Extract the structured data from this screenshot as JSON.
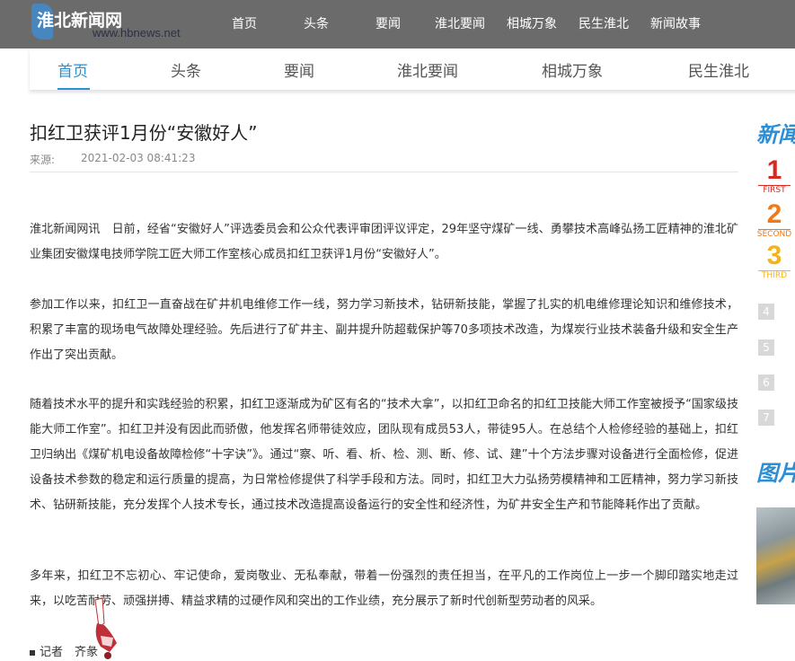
{
  "header": {
    "logo_name": "淮北新闻网",
    "logo_url": "www.hbnews.net",
    "nav": [
      "首页",
      "头条",
      "要闻",
      "淮北要闻",
      "相城万象",
      "民生淮北",
      "新闻故事"
    ]
  },
  "subnav": {
    "items": [
      "首页",
      "头条",
      "要闻",
      "淮北要闻",
      "相城万象",
      "民生淮北"
    ],
    "active_index": 0,
    "accent_color": "#2b8fd6"
  },
  "article": {
    "title": "扣红卫获评1月份“安徽好人”",
    "source_label": "来源:",
    "date": "2021-02-03 08:41:23",
    "paragraphs": [
      "淮北新闻网讯　日前，经省“安徽好人”评选委员会和公众代表评审团评议评定，29年坚守煤矿一线、勇攀技术高峰弘扬工匠精神的淮北矿业集团安徽煤电技师学院工匠大师工作室核心成员扣红卫获评1月份“安徽好人”。",
      "参加工作以来，扣红卫一直奋战在矿井机电维修工作一线，努力学习新技术，钻研新技能，掌握了扎实的机电维修理论知识和维修技术，积累了丰富的现场电气故障处理经验。先后进行了矿井主、副井提升防超载保护等70多项技术改造，为煤炭行业技术装备升级和安全生产作出了突出贡献。",
      "随着技术水平的提升和实践经验的积累，扣红卫逐渐成为矿区有名的“技术大拿”，以扣红卫命名的扣红卫技能大师工作室被授予“国家级技能大师工作室”。扣红卫并没有因此而骄傲，他发挥名师带徒效应，团队现有成员53人，带徒95人。在总结个人检修经验的基础上，扣红卫归纳出《煤矿机电设备故障检修“十字诀”》。通过“察、听、看、析、检、测、断、修、试、建”十个方法步骤对设备进行全面检修，促进设备技术参数的稳定和运行质量的提高，为日常检修提供了科学手段和方法。同时，扣红卫大力弘扬劳模精神和工匠精神，努力学习新技术、钻研新技能，充分发挥个人技术专长，通过技术改造提高设备运行的安全性和经济性，为矿井安全生产和节能降耗作出了贡献。",
      "多年来，扣红卫不忘初心、牢记使命，爱岗敬业、无私奉献，带着一份强烈的责任担当，在平凡的工作岗位上一步一个脚印踏实地走过来，以吃苦耐劳、顽强拼搏、精益求精的过硬作风和突出的工作业绩，充分展示了新时代创新型劳动者的风采。"
    ],
    "reporter": "记者　齐彖"
  },
  "sidebar": {
    "title1": "新闻",
    "rank_labels": [
      "FIRST",
      "SECOND",
      "THIRD"
    ],
    "rank_numbers": [
      "1",
      "2",
      "3"
    ],
    "rank_more": [
      "4",
      "5",
      "6",
      "7"
    ],
    "title2": "图片",
    "rank_colors": [
      "#d7291f",
      "#f07a18",
      "#f2b31b"
    ]
  }
}
